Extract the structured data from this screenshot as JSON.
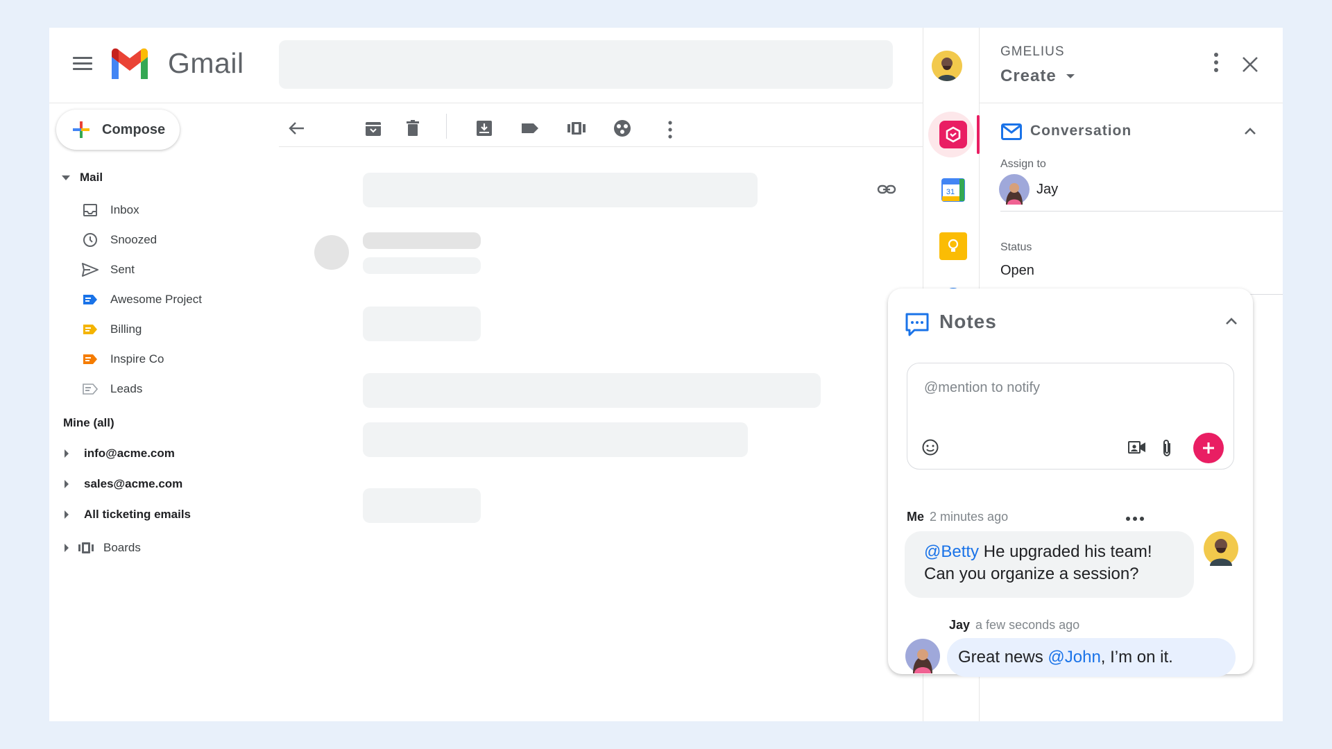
{
  "app": {
    "name": "Gmail"
  },
  "sidebar": {
    "compose_label": "Compose",
    "mail_section": "Mail",
    "items": [
      {
        "label": "Inbox",
        "icon": "inbox-icon"
      },
      {
        "label": "Snoozed",
        "icon": "clock-icon"
      },
      {
        "label": "Sent",
        "icon": "send-icon"
      },
      {
        "label": "Awesome Project",
        "icon": "label-icon",
        "color": "#1a73e8"
      },
      {
        "label": "Billing",
        "icon": "label-icon",
        "color": "#f4b400"
      },
      {
        "label": "Inspire Co",
        "icon": "label-icon",
        "color": "#f57c00"
      },
      {
        "label": "Leads",
        "icon": "label-icon",
        "color": "#9aa0a6"
      }
    ],
    "mine_section": "Mine (all)",
    "accounts": [
      "info@acme.com",
      "sales@acme.com",
      "All ticketing emails"
    ],
    "boards_label": "Boards"
  },
  "gmelius": {
    "brand": "GMELIUS",
    "mode": "Create",
    "accent": "#e91e63",
    "conversation": {
      "title": "Conversation",
      "assign_label": "Assign to",
      "assignee": "Jay",
      "status_label": "Status",
      "status": "Open"
    },
    "notes": {
      "title": "Notes",
      "placeholder": "@mention to notify",
      "messages": [
        {
          "author": "Me",
          "time": "2 minutes ago",
          "mention": "@Betty",
          "text1": " He upgraded his team!",
          "text2": "Can you organize a session?"
        },
        {
          "author": "Jay",
          "time": "a few seconds ago",
          "prefix": "Great news ",
          "mention": "@John",
          "suffix": ", I’m on it."
        }
      ]
    }
  }
}
